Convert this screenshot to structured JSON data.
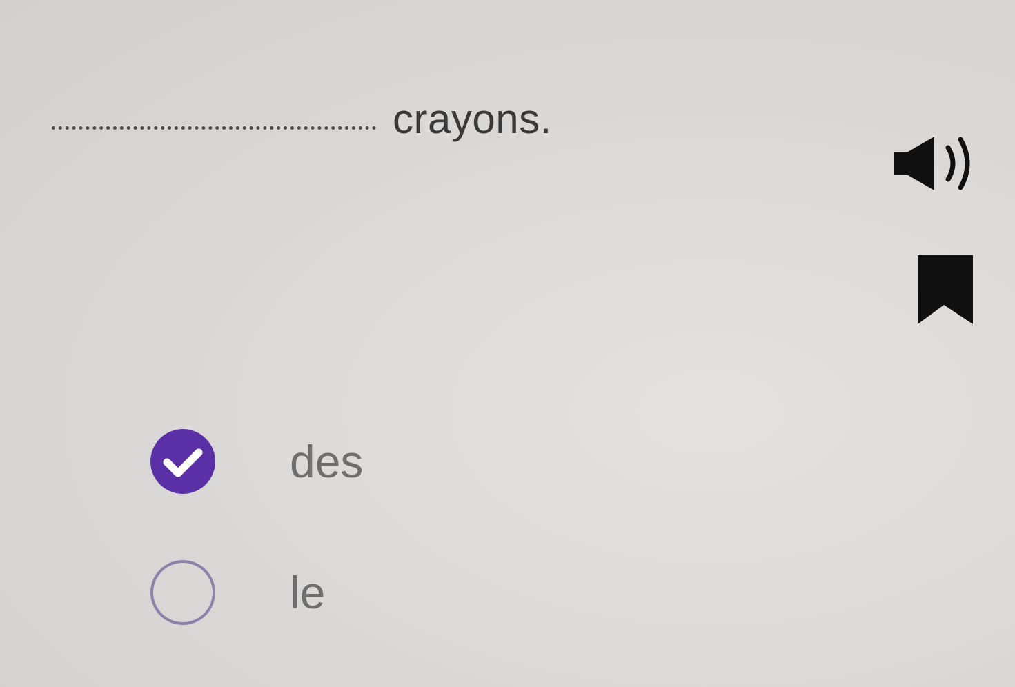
{
  "question": {
    "sentence_end": "crayons."
  },
  "icons": {
    "audio": "speaker-icon",
    "bookmark": "bookmark-icon"
  },
  "options": [
    {
      "label": "des",
      "selected": true
    },
    {
      "label": "le",
      "selected": false
    }
  ],
  "colors": {
    "accent": "#5b2fa6",
    "background": "#dcdad8",
    "text": "#3a3a3a",
    "option_text": "#6e6e6e"
  }
}
